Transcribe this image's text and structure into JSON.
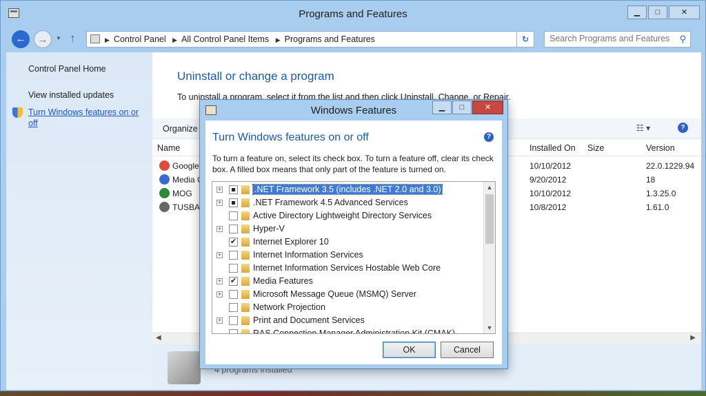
{
  "window": {
    "title": "Programs and Features",
    "minimize": "▁",
    "maximize": "□",
    "close": "✕"
  },
  "address": {
    "breadcrumbs": [
      "Control Panel",
      "All Control Panel Items",
      "Programs and Features"
    ],
    "search_placeholder": "Search Programs and Features"
  },
  "leftpane": {
    "items": [
      {
        "label": "Control Panel Home"
      },
      {
        "label": "View installed updates"
      },
      {
        "label": "Turn Windows features on or off"
      }
    ]
  },
  "content": {
    "heading": "Uninstall or change a program",
    "description": "To uninstall a program, select it from the list and then click Uninstall, Change, or Repair.",
    "organize": "Organize ▾",
    "columns": {
      "name": "Name",
      "installed_on": "Installed On",
      "size": "Size",
      "version": "Version"
    },
    "rows": [
      {
        "name": "Google",
        "installed_on": "10/10/2012",
        "size": "",
        "version": "22.0.1229.94",
        "icon_color": "#e04a3a"
      },
      {
        "name": "Media C",
        "installed_on": "9/20/2012",
        "size": "",
        "version": "18",
        "icon_color": "#3a6ad0"
      },
      {
        "name": "MOG",
        "installed_on": "10/10/2012",
        "size": "",
        "version": "1.3.25.0",
        "icon_color": "#2a8a3a"
      },
      {
        "name": "TUSBA",
        "installed_on": "10/8/2012",
        "size": "",
        "version": "1.61.0",
        "icon_color": "#666666"
      }
    ],
    "status_text": "4 programs installed"
  },
  "dialog": {
    "title": "Windows Features",
    "heading": "Turn Windows features on or off",
    "help": "?",
    "description": "To turn a feature on, select its check box. To turn a feature off, clear its check box. A filled box means that only part of the feature is turned on.",
    "features": [
      {
        "label": ".NET Framework 3.5 (includes .NET 2.0 and 3.0)",
        "expandable": true,
        "state": "partial",
        "selected": true
      },
      {
        "label": ".NET Framework 4.5 Advanced Services",
        "expandable": true,
        "state": "partial",
        "selected": false
      },
      {
        "label": "Active Directory Lightweight Directory Services",
        "expandable": false,
        "state": "off",
        "selected": false
      },
      {
        "label": "Hyper-V",
        "expandable": true,
        "state": "off",
        "selected": false
      },
      {
        "label": "Internet Explorer 10",
        "expandable": false,
        "state": "on",
        "selected": false
      },
      {
        "label": "Internet Information Services",
        "expandable": true,
        "state": "off",
        "selected": false
      },
      {
        "label": "Internet Information Services Hostable Web Core",
        "expandable": false,
        "state": "off",
        "selected": false
      },
      {
        "label": "Media Features",
        "expandable": true,
        "state": "on",
        "selected": false
      },
      {
        "label": "Microsoft Message Queue (MSMQ) Server",
        "expandable": true,
        "state": "off",
        "selected": false
      },
      {
        "label": "Network Projection",
        "expandable": false,
        "state": "off",
        "selected": false
      },
      {
        "label": "Print and Document Services",
        "expandable": true,
        "state": "off",
        "selected": false
      },
      {
        "label": "RAS Connection Manager Administration Kit (CMAK)",
        "expandable": false,
        "state": "off",
        "selected": false
      }
    ],
    "ok_label": "OK",
    "cancel_label": "Cancel"
  }
}
